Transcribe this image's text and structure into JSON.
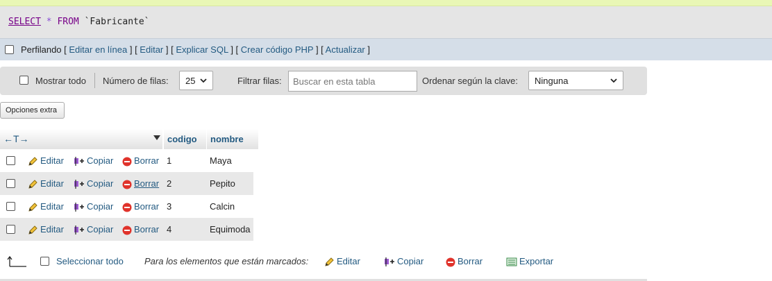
{
  "query": {
    "select": "SELECT",
    "star": "*",
    "from": "FROM",
    "table": "`Fabricante`"
  },
  "profiling": {
    "label": "Perfilando",
    "links": [
      "Editar en línea",
      "Editar",
      "Explicar SQL",
      "Crear código PHP",
      "Actualizar"
    ]
  },
  "nav": {
    "show_all": "Mostrar todo",
    "rows_label": "Número de filas:",
    "rows_value": "25",
    "filter_label": "Filtrar filas:",
    "search_placeholder": "Buscar en esta tabla",
    "sort_label": "Ordenar según la clave:",
    "sort_value": "Ninguna"
  },
  "extra_options": "Opciones extra",
  "table": {
    "arrows": "←T→",
    "columns": [
      "codigo",
      "nombre"
    ],
    "actions": {
      "edit": "Editar",
      "copy": "Copiar",
      "delete": "Borrar"
    },
    "rows": [
      {
        "codigo": "1",
        "nombre": "Maya"
      },
      {
        "codigo": "2",
        "nombre": "Pepito"
      },
      {
        "codigo": "3",
        "nombre": "Calcin"
      },
      {
        "codigo": "4",
        "nombre": "Equimoda"
      }
    ]
  },
  "footer": {
    "select_all": "Seleccionar todo",
    "with_selected": "Para los elementos que están marcados:",
    "edit": "Editar",
    "copy": "Copiar",
    "delete": "Borrar",
    "export": "Exportar"
  }
}
